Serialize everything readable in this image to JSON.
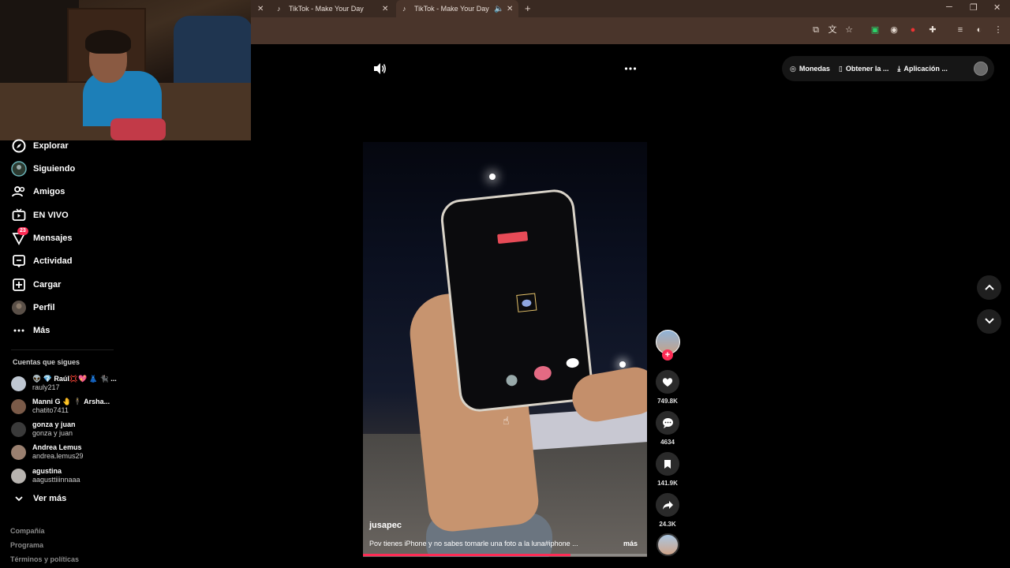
{
  "browser": {
    "tabs": [
      {
        "title": "TikTok - Make Your Day"
      },
      {
        "title": "TikTok - Make Your Day"
      }
    ],
    "new_tab_glyph": "+"
  },
  "sidebar": {
    "items": [
      {
        "label": "Explorar",
        "icon": "compass-icon"
      },
      {
        "label": "Siguiendo",
        "icon": "following-avatar-icon"
      },
      {
        "label": "Amigos",
        "icon": "friends-icon"
      },
      {
        "label": "EN VIVO",
        "icon": "live-tv-icon"
      },
      {
        "label": "Mensajes",
        "icon": "messages-icon",
        "badge": "23"
      },
      {
        "label": "Actividad",
        "icon": "activity-icon"
      },
      {
        "label": "Cargar",
        "icon": "upload-icon"
      },
      {
        "label": "Perfil",
        "icon": "profile-avatar-icon"
      },
      {
        "label": "Más",
        "icon": "more-dots-icon"
      }
    ],
    "following_title": "Cuentas que sigues",
    "accounts": [
      {
        "name": "👽 💎 Raúl💢💖 👗 🐈‍⬛ ...",
        "handle": "rauly217"
      },
      {
        "name": "Manni G 🤚 🕴 Arsha...",
        "handle": "chatito7411"
      },
      {
        "name": "gonza y juan",
        "handle": "gonza y juan"
      },
      {
        "name": "Andrea Lemus",
        "handle": "andrea.lemus29"
      },
      {
        "name": "agustina",
        "handle": "aagusttiiinnaaa"
      }
    ],
    "see_more": "Ver más",
    "footer": [
      "Compañía",
      "Programa",
      "Términos y políticas"
    ]
  },
  "header": {
    "coins": "Monedas",
    "get_app": "Obtener la ...",
    "download_app": "Aplicación ..."
  },
  "video": {
    "username": "jusapec",
    "caption": "Pov tienes iPhone y no sabes tomarle una foto a la luna#iphone ...",
    "more": "más",
    "progress": 0.73
  },
  "actions": {
    "likes": "749.8K",
    "comments": "4634",
    "saves": "141.9K",
    "shares": "24.3K"
  },
  "colors": {
    "accent": "#fe2c55",
    "chrome_bg": "#3a2a22"
  }
}
